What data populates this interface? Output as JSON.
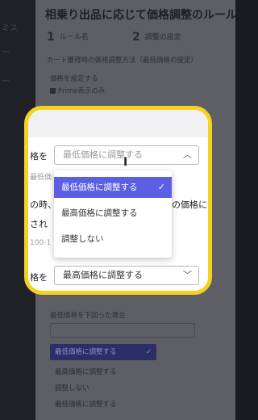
{
  "background": {
    "title": "相乗り出品に応じて価格調整のルール",
    "steps": [
      {
        "num": "1",
        "text": "ルール名"
      },
      {
        "num": "2",
        "text": "調整の設定"
      }
    ],
    "description": "カート獲得時の価格調整方法（最低価格の設定）",
    "section_label": "価格を設定する",
    "checkbox_label": "Prime表示のみ",
    "lower_label": "最低価格を下回った場合",
    "lower_options": [
      "最低価格に調整する",
      "最高価格に調整する",
      "調整しない",
      "最低価格に調整する"
    ]
  },
  "zoom": {
    "row1_label": "格を",
    "row1_placeholder": "最低価格に調整する",
    "faint_label": "最低価",
    "body_line1": "の時、",
    "body_line1_right": "の価格に",
    "body_line2": "され",
    "body_line3": "100-1",
    "row2_label": "格を",
    "row2_value": "最高価格に調整する",
    "menu": [
      {
        "label": "最低価格に調整する",
        "selected": true
      },
      {
        "label": "最高価格に調整する",
        "selected": false
      },
      {
        "label": "調整しない",
        "selected": false
      }
    ],
    "colors": {
      "highlight": "#f4d21f",
      "selected": "#5b5fe3"
    }
  }
}
